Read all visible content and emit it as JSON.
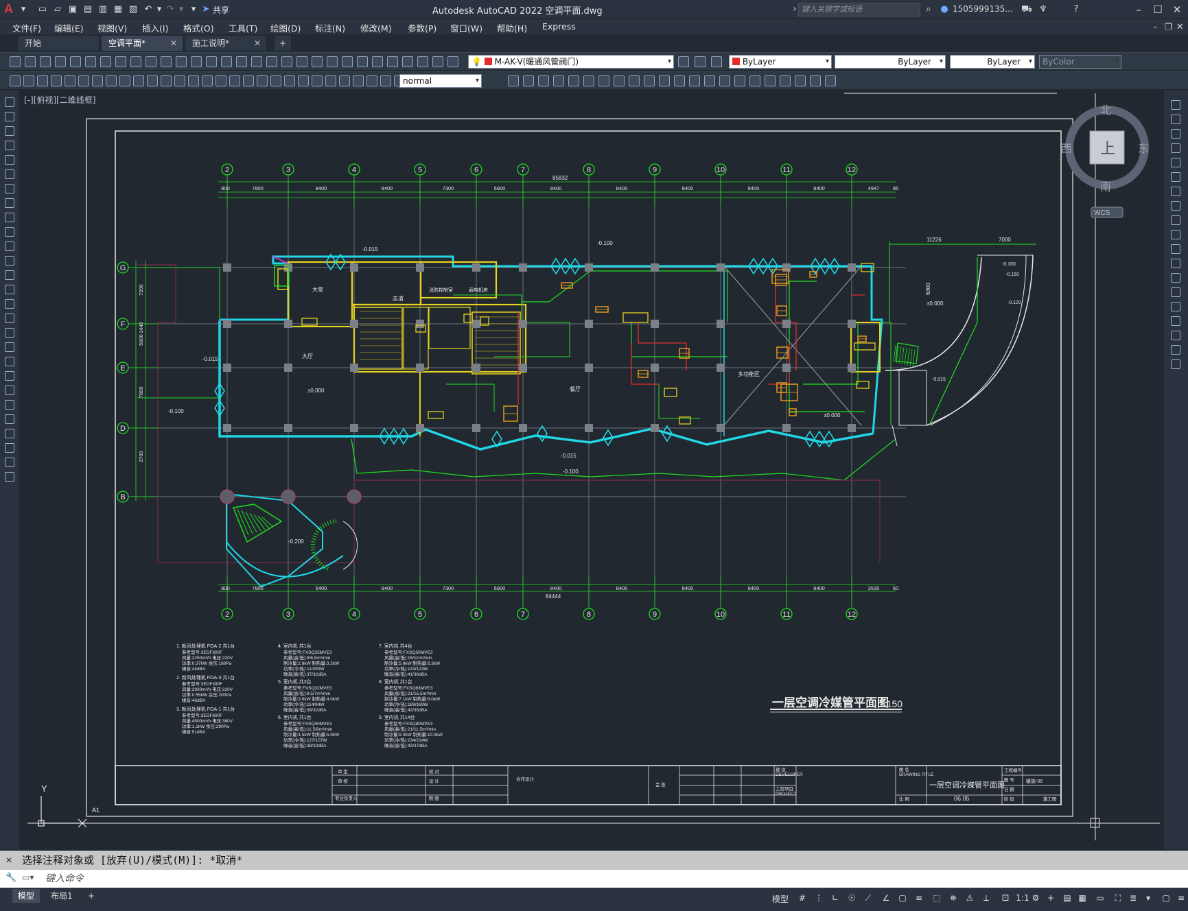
{
  "titlebar": {
    "app_title": "Autodesk AutoCAD 2022    空调平面.dwg",
    "share_label": "共享",
    "search_placeholder": "键入关键字或短语",
    "user_name": "1505999135...",
    "logo_letter": "A"
  },
  "menu": [
    "文件(F)",
    "编辑(E)",
    "视图(V)",
    "插入(I)",
    "格式(O)",
    "工具(T)",
    "绘图(D)",
    "标注(N)",
    "修改(M)",
    "参数(P)",
    "窗口(W)",
    "帮助(H)",
    "Express"
  ],
  "tabs": [
    {
      "label": "开始"
    },
    {
      "label": "空调平面*",
      "active": true
    },
    {
      "label": "施工说明*"
    }
  ],
  "toolbar": {
    "layer_value": "M-AK-V(暖通风管阀门)",
    "color_value": "ByLayer",
    "linetype_value": "ByLayer",
    "lineweight_value": "ByLayer",
    "plotstyle_value": "ByColor",
    "textstyle_value": "normal"
  },
  "viewport_label": "[-][俯视][二维线框]",
  "viewcube": {
    "north": "北",
    "south": "南",
    "east": "东",
    "west": "西",
    "top": "上",
    "ucs": "WCS"
  },
  "drawing": {
    "title": "一层空调冷媒管平面图",
    "scale": "1:150",
    "sheet_size": "A1",
    "axis_top": [
      "2",
      "3",
      "4",
      "5",
      "6",
      "7",
      "8",
      "9",
      "10",
      "11",
      "12"
    ],
    "axis_left": [
      "G",
      "F",
      "E",
      "D",
      "B"
    ],
    "total_top": "85832",
    "total_bottom": "84444",
    "dims_top": [
      "800",
      "7800",
      "8400",
      "8400",
      "7300",
      "5900",
      "8400",
      "8400",
      "8400",
      "8400",
      "8400",
      "4947",
      "85"
    ],
    "dims_bottom": [
      "800",
      "7800",
      "6400",
      "8400",
      "7300",
      "5900",
      "8400",
      "8400",
      "8400",
      "8400",
      "8400",
      "3535",
      "50"
    ],
    "dims_left": [
      "7200",
      "5500",
      "7800",
      "3700",
      "1440"
    ],
    "dims_right": [
      "11226",
      "7000",
      "6300"
    ],
    "rooms": [
      "大堂",
      "走道",
      "消防控制室",
      "弱电机房",
      "大厅",
      "餐厅",
      "多功能区"
    ],
    "levels": [
      "-0.015",
      "-0.100",
      "±0.000",
      "-0.200",
      "-0.120",
      "-0.150",
      "-0.100"
    ],
    "title_block": {
      "drawing_title": "一层空调冷媒管平面图",
      "date": "06.05",
      "drawing_no": "暖施-06",
      "labels": [
        "审 定",
        "审 核",
        "专业负责人",
        "校 对",
        "设 计",
        "制 图",
        "合作设计:",
        "会 签",
        "建 设",
        "DEVELOPER",
        "工程项目",
        "PROJECT",
        "图 名",
        "DRAWING TITLE",
        "工程编号",
        "图 号",
        "比 例",
        "日 期",
        "阶 段",
        "施工图"
      ]
    }
  },
  "equipment_notes": [
    {
      "title": "1. 新风处理机  FOA-2  共1台",
      "lines": [
        "参考型号:3EDF300F",
        "风量:2250m³/h  电压:220V",
        "功率:0.37kW  余压:180Pa",
        "噪音:44dBA"
      ]
    },
    {
      "title": "2. 新风处理机  FOA-3  共1台",
      "lines": [
        "参考型号:3EDF390F",
        "风量:2930m³/h  电压:220V",
        "功率:0.55kW  余压:200Pa",
        "噪音:46dBA"
      ]
    },
    {
      "title": "3. 新风处理机  FOA-1  共1台",
      "lines": [
        "参考型号:3EDF600F",
        "风量:4500m³/h  电压:380V",
        "功率:1.1kW  余压:290Pa",
        "噪音:51dBA"
      ]
    },
    {
      "title": "4. 室内机  共1台",
      "lines": [
        "参考型号:FXSQ25MVE3",
        "风量(高/低):9/6.5m³/min",
        "制冷量:2.8kW  制热量:3.2kW",
        "功率(冷/热):110/90W",
        "噪音(高/低):37/32dBA"
      ]
    },
    {
      "title": "5. 室内机  共3台",
      "lines": [
        "参考型号:FXSQ32MVE3",
        "风量(高/低):9.5/7m³/min",
        "制冷量:3.6kW  制热量:4.0kW",
        "功率(冷/热):114/94W",
        "噪音(高/低):38/32dBA"
      ]
    },
    {
      "title": "6. 室内机  共1台",
      "lines": [
        "参考型号:FXSQ40MVE3",
        "风量(高/低):11.5/9m³/min",
        "制冷量:4.5kW  制热量:5.0kW",
        "功率(冷/热):127/107W",
        "噪音(高/低):38/32dBA"
      ]
    },
    {
      "title": "7. 室内机  共4台",
      "lines": [
        "参考型号:FXSQ50MVE3",
        "风量(高/低):15/11m³/min",
        "制冷量:5.6kW  制热量:6.3kW",
        "功率(冷/热):143/123W",
        "噪音(高/低):41/36dBA"
      ]
    },
    {
      "title": "8. 室内机  共1台",
      "lines": [
        "参考型号:FXSQ63MVE3",
        "风量(高/低):21/15.5m³/min",
        "制冷量:7.1kW  制热量:8.0kW",
        "功率(冷/热):189/169W",
        "噪音(高/低):42/35dBA"
      ]
    },
    {
      "title": "9. 室内机  共14台",
      "lines": [
        "参考型号:FXSQ80MVE3",
        "风量(高/低):21/11.5m³/min",
        "制冷量:9.0kW  制热量:10.0kW",
        "功率(冷/热):234/214W",
        "噪音(高/低):43/37dBA"
      ]
    }
  ],
  "command": {
    "history": "选择注释对象或 [放弃(U)/模式(M)]: *取消*",
    "placeholder": "键入命令"
  },
  "status": {
    "layout_tabs": [
      "模型",
      "布局1"
    ],
    "model_label": "模型",
    "scale_label": "1:1"
  },
  "colors": {
    "cyan": "#21d7e6",
    "green": "#1fe01f",
    "yellow": "#e6d21f",
    "red": "#e62b2b",
    "magenta": "#c23ad8",
    "grey": "#8a8f98",
    "white": "#e8e8e8"
  }
}
